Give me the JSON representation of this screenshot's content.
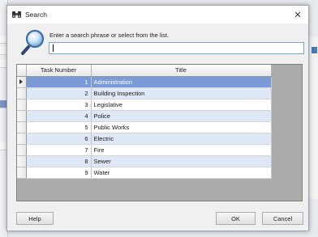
{
  "dialog": {
    "title": "Search",
    "close_glyph": "✕",
    "title_icon": "binoculars-icon",
    "search_icon": "magnifier-icon"
  },
  "search": {
    "prompt": "Enter a search phrase or select from the list.",
    "value": "",
    "placeholder": ""
  },
  "grid": {
    "columns": [
      "Task Number",
      "Title"
    ],
    "rows": [
      {
        "task_number": "1",
        "title": "Administration",
        "selected": true
      },
      {
        "task_number": "2",
        "title": "Building Inspection",
        "selected": false
      },
      {
        "task_number": "3",
        "title": "Legislative",
        "selected": false
      },
      {
        "task_number": "4",
        "title": "Police",
        "selected": false
      },
      {
        "task_number": "5",
        "title": "Public Works",
        "selected": false
      },
      {
        "task_number": "6",
        "title": "Electric",
        "selected": false
      },
      {
        "task_number": "7",
        "title": "Fire",
        "selected": false
      },
      {
        "task_number": "8",
        "title": "Sewer",
        "selected": false
      },
      {
        "task_number": "9",
        "title": "Water",
        "selected": false
      }
    ]
  },
  "buttons": {
    "help": "Help",
    "ok": "OK",
    "cancel": "Cancel"
  },
  "colors": {
    "selected_row": "#7b9bd8",
    "alt_row": "#dfe8f6",
    "input_border": "#7aa7d6"
  }
}
